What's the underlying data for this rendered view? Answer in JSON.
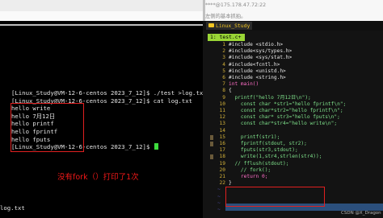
{
  "ssh": {
    "title": "****@175.178.47.72:22",
    "subtitle": "左侧的基本抓拍。"
  },
  "vim": {
    "tab_label": "Linux_Study",
    "buffer_tab": "1: test.c+"
  },
  "terminal": {
    "lines": [
      "[Linux_Study@VM-12-6-centos 2023_7_12]$ ./test >log.txt",
      "[Linux_Study@VM-12-6-centos 2023_7_12]$ cat log.txt",
      "hello write",
      "hello 7月12日",
      "hello printf",
      "hello fprintf",
      "hello fputs",
      "[Linux_Study@VM-12-6-centos 2023_7_12]$ "
    ],
    "annotation": "没有fork（）打印了1次",
    "bottom_text": "log.txt"
  },
  "code": [
    {
      "n": "1",
      "t": "#include <stdio.h>",
      "k": "pp"
    },
    {
      "n": "2",
      "t": "#include<sys/types.h>",
      "k": "pp"
    },
    {
      "n": "3",
      "t": "#include <sys/stat.h>",
      "k": "pp"
    },
    {
      "n": "4",
      "t": "#include<fcntl.h>",
      "k": "pp"
    },
    {
      "n": "5",
      "t": "#include <unistd.h>",
      "k": "pp"
    },
    {
      "n": "6",
      "t": "#include <string.h>",
      "k": "pp"
    },
    {
      "n": "7",
      "t": "int main()",
      "k": "kw"
    },
    {
      "n": "8",
      "t": "{",
      "k": "pp"
    },
    {
      "n": "9",
      "t": "  printf(\"hello 7月12日\\n\");",
      "k": "str"
    },
    {
      "n": "10",
      "t": "    const char *str1=\"hello fprintf\\n\";",
      "k": "str"
    },
    {
      "n": "11",
      "t": "    const char*str2=\"hello fprintf\\n\";",
      "k": "str"
    },
    {
      "n": "12",
      "t": "    const char* str3=\"hello fputs\\n\";",
      "k": "str"
    },
    {
      "n": "13",
      "t": "    const char*str4=\"hello write\\n\";",
      "k": "str"
    },
    {
      "n": "14",
      "t": "",
      "k": "pp"
    },
    {
      "n": "15",
      "t": "    printf(str1);",
      "k": "str"
    },
    {
      "n": "16",
      "t": "    fprintf(stdout, str2);",
      "k": "str"
    },
    {
      "n": "17",
      "t": "    fputs(str3,stdout);",
      "k": "str"
    },
    {
      "n": "18",
      "t": "    write(1,str4,strlen(str4));",
      "k": "str"
    },
    {
      "n": "19",
      "t": "  // fflush(stdout);",
      "k": "str"
    },
    {
      "n": "20",
      "t": "    // fork();",
      "k": "str"
    },
    {
      "n": "21",
      "t": "    return 0;",
      "k": "kw"
    },
    {
      "n": "22",
      "t": "}",
      "k": "pp"
    }
  ],
  "watermark": "CSDN @X_Dragon"
}
